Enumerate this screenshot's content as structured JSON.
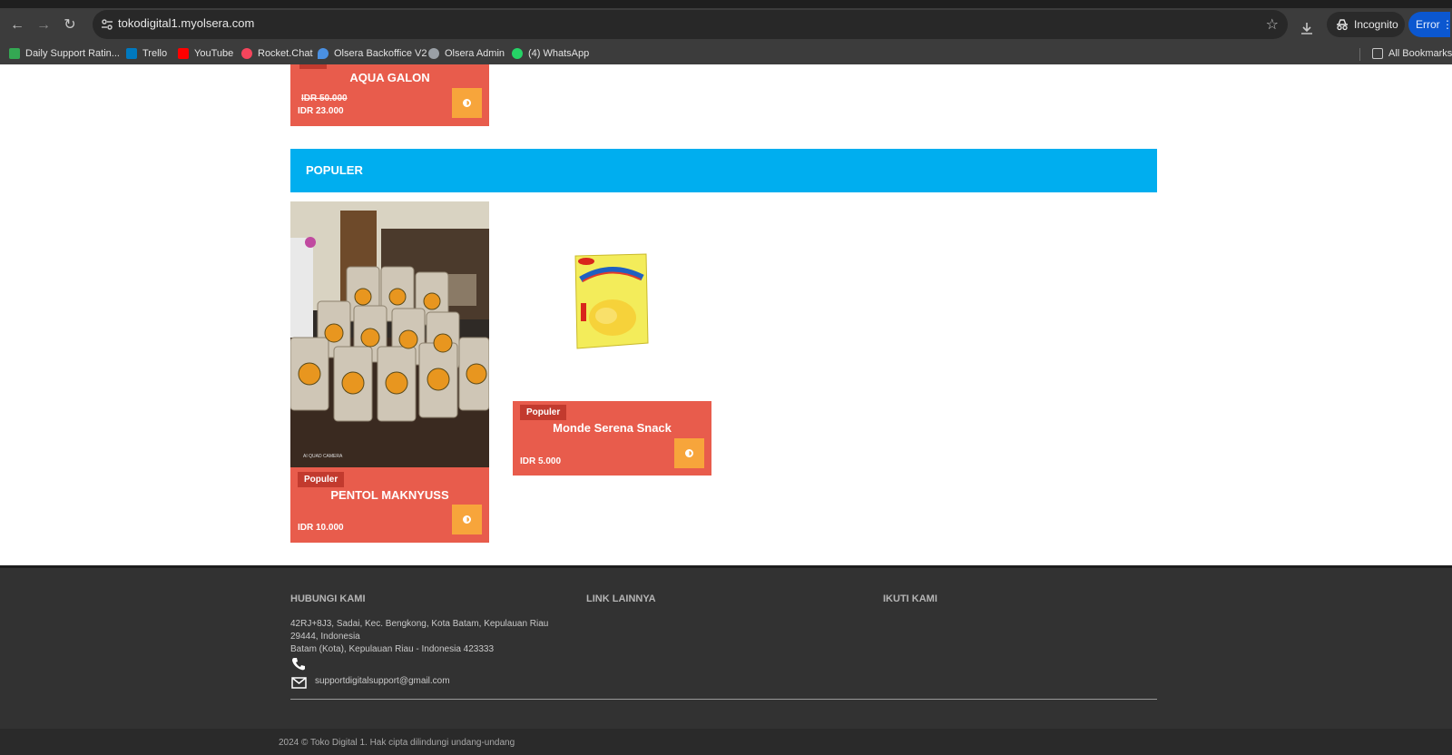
{
  "browser": {
    "url": "tokodigital1.myolsera.com",
    "incognito_label": "Incognito",
    "error_label": "Error",
    "bookmarks": [
      {
        "label": "Daily Support Ratin...",
        "color": "#34a853"
      },
      {
        "label": "Trello",
        "color": "#0079bf"
      },
      {
        "label": "YouTube",
        "color": "#ff0000"
      },
      {
        "label": "Rocket.Chat",
        "color": "#f5455c"
      },
      {
        "label": "Olsera Backoffice V2",
        "color": "#4a90e2"
      },
      {
        "label": "Olsera Admin",
        "color": "#9aa0a6"
      },
      {
        "label": "(4) WhatsApp",
        "color": "#25d366"
      }
    ],
    "all_bookmarks_label": "All Bookmarks"
  },
  "top_product": {
    "title": "AQUA GALON",
    "price_old": "IDR 50.000",
    "price": "IDR 23.000"
  },
  "section": {
    "title": "POPULER"
  },
  "products": [
    {
      "badge": "Populer",
      "title": "PENTOL MAKNYUSS",
      "price": "IDR 10.000",
      "photo_caption": "AI QUAD CAMERA"
    },
    {
      "badge": "Populer",
      "title": "Monde Serena Snack",
      "price": "IDR 5.000"
    }
  ],
  "footer": {
    "contact_title": "HUBUNGI KAMI",
    "address_line1": "42RJ+8J3, Sadai, Kec. Bengkong, Kota Batam, Kepulauan Riau",
    "address_line2": "29444, Indonesia",
    "address_line3": "Batam (Kota), Kepulauan Riau - Indonesia 423333",
    "email": "supportdigitalsupport@gmail.com",
    "links_title": "LINK LAINNYA",
    "follow_title": "IKUTI KAMI",
    "copyright": "2024 © Toko Digital 1. Hak cipta dilindungi undang-undang"
  },
  "colors": {
    "card": "#e85c4c",
    "badge": "#c23a2e",
    "cart_button": "#f7a53b",
    "section_bar": "#00aeef",
    "footer": "#323232"
  }
}
